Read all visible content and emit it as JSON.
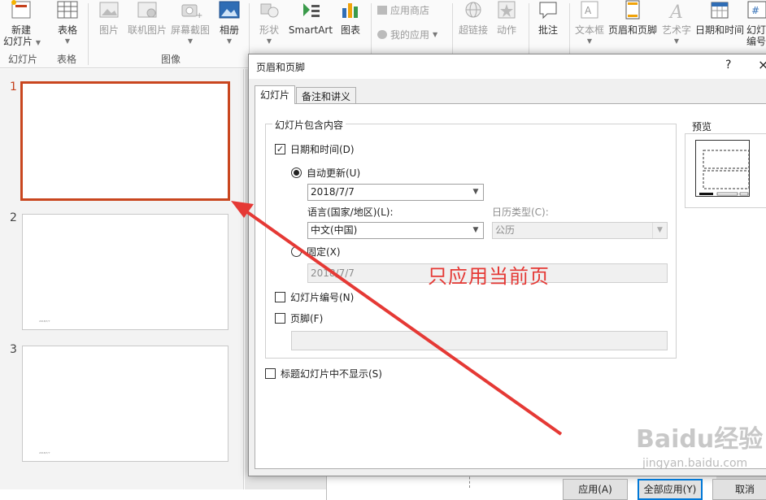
{
  "ribbon": {
    "new_slide_line1": "新建",
    "new_slide_line2": "幻灯片",
    "table": "表格",
    "picture": "图片",
    "online_picture": "联机图片",
    "screenshot": "屏幕截图",
    "album": "相册",
    "shapes": "形状",
    "smartart": "SmartArt",
    "chart": "图表",
    "app_store": "应用商店",
    "my_apps": "我的应用",
    "hyperlink": "超链接",
    "action": "动作",
    "comment": "批注",
    "textbox": "文本框",
    "header_footer": "页眉和页脚",
    "wordart": "艺术字",
    "date_time": "日期和时间",
    "slide_number_line1": "幻灯",
    "slide_number_line2": "编号",
    "groups": {
      "slides": "幻灯片",
      "tables": "表格",
      "images": "图像"
    }
  },
  "thumbnails": [
    {
      "number": "1",
      "footer": ""
    },
    {
      "number": "2",
      "footer": "2018/7/7"
    },
    {
      "number": "3",
      "footer": "2018/7/7"
    }
  ],
  "dialog": {
    "title": "页眉和页脚",
    "help": "?",
    "close": "×",
    "tabs": [
      "幻灯片",
      "备注和讲义"
    ],
    "group_title": "幻灯片包含内容",
    "date_time_label": "日期和时间(D)",
    "auto_update_label": "自动更新(U)",
    "auto_date_value": "2018/7/7",
    "language_label": "语言(国家/地区)(L):",
    "language_value": "中文(中国)",
    "calendar_label": "日历类型(C):",
    "calendar_value": "公历",
    "fixed_label": "固定(X)",
    "fixed_value": "2018/7/7",
    "slide_number_label": "幻灯片编号(N)",
    "footer_label": "页脚(F)",
    "footer_value": "",
    "dont_show_title_label": "标题幻灯片中不显示(S)",
    "preview_label": "预览",
    "apply_button": "应用(A)",
    "apply_all_button": "全部应用(Y)",
    "cancel_button": "取消"
  },
  "annotation": {
    "text": "只应用当前页",
    "color": "#e53935"
  },
  "watermark": {
    "main": "Baidu经验",
    "sub": "jingyan.baidu.com"
  }
}
